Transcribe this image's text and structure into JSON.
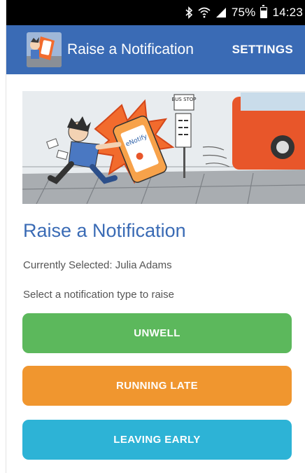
{
  "status_bar": {
    "battery": "75%",
    "time": "14:23",
    "battery_level": 0.75,
    "icons": [
      "bluetooth-icon",
      "wifi-icon",
      "signal-icon",
      "battery-icon"
    ]
  },
  "app_bar": {
    "title": "Raise a Notification",
    "settings_label": "SETTINGS",
    "color": "#3a6bb5"
  },
  "hero": {
    "bus_stop_text": "BUS STOP",
    "phone_text": "eNotify"
  },
  "main": {
    "heading": "Raise a Notification",
    "selected_text": "Currently Selected: Julia Adams",
    "prompt": "Select a notification type to raise"
  },
  "buttons": [
    {
      "label": "UNWELL",
      "color": "#5cb85c"
    },
    {
      "label": "RUNNING LATE",
      "color": "#f0962f"
    },
    {
      "label": "LEAVING EARLY",
      "color": "#2db3d6"
    }
  ]
}
